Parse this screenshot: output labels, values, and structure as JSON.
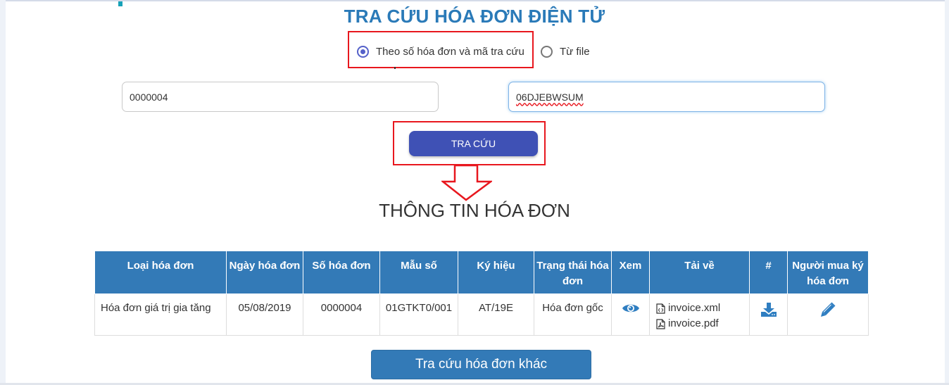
{
  "page": {
    "title": "TRA CỨU HÓA ĐƠN ĐIỆN TỬ",
    "section_title": "THÔNG TIN HÓA ĐƠN"
  },
  "search_mode": {
    "options": [
      {
        "label": "Theo số hóa đơn và mã tra cứu",
        "checked": true
      },
      {
        "label": "Từ file",
        "checked": false
      }
    ]
  },
  "form": {
    "invoice_number": "0000004",
    "lookup_code": "06DJEBWSUM",
    "search_button": "TRA CỨU"
  },
  "table": {
    "headers": [
      "Loại hóa đơn",
      "Ngày hóa đơn",
      "Số hóa đơn",
      "Mẫu số",
      "Ký hiệu",
      "Trạng thái hóa đơn",
      "Xem",
      "Tải về",
      "#",
      "Người mua ký hóa đơn"
    ],
    "rows": [
      {
        "type": "Hóa đơn giá trị gia tăng",
        "date": "05/08/2019",
        "number": "0000004",
        "form": "01GTKT0/001",
        "symbol": "AT/19E",
        "status": "Hóa đơn gốc",
        "view_icon": "eye-icon",
        "files": [
          "invoice.xml",
          "invoice.pdf"
        ],
        "download_icon": "download-icon",
        "sign_icon": "pencil-icon"
      }
    ]
  },
  "other_button": "Tra cứu hóa đơn khác",
  "colors": {
    "title": "#2a7ab8",
    "table_header": "#337ab7",
    "primary_button": "#3f51b5",
    "highlight": "#e8171e"
  }
}
